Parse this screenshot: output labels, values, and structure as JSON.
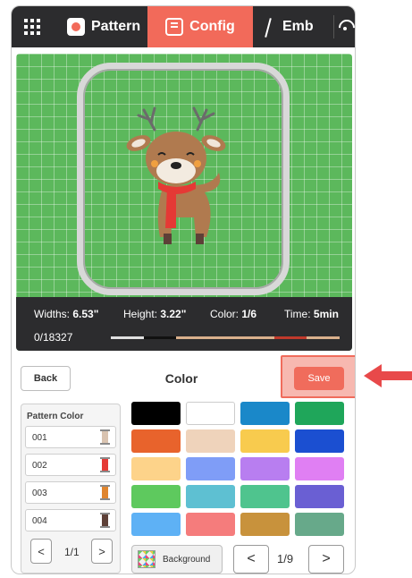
{
  "topbar": {
    "tabs": [
      {
        "label": "Pattern",
        "icon": "pattern-icon"
      },
      {
        "label": "Config",
        "icon": "config-icon",
        "active": true
      },
      {
        "label": "Emb",
        "icon": "needle-icon"
      }
    ]
  },
  "stats": {
    "widths_label": "Widths: ",
    "widths_value": "6.53\"",
    "height_label": "Height: ",
    "height_value": "3.22\"",
    "color_label": "Color: ",
    "color_value": "1/6",
    "time_label": "Time: ",
    "time_value": "5min",
    "counter": "0/18327",
    "progress_colors": [
      "#e0e0e0",
      "#111111",
      "#d9b08c",
      "#d9b08c",
      "#d9b08c",
      "#c0392b",
      "#d9b08c"
    ]
  },
  "panel": {
    "back_label": "Back",
    "title": "Color",
    "save_label": "Save",
    "pattern_color_title": "Pattern Color",
    "pattern_colors": [
      {
        "num": "001",
        "color": "#d9c3b0"
      },
      {
        "num": "002",
        "color": "#e53935"
      },
      {
        "num": "003",
        "color": "#e0852e"
      },
      {
        "num": "004",
        "color": "#5d4037"
      }
    ],
    "pattern_pager": {
      "prev": "<",
      "text": "1/1",
      "next": ">"
    },
    "palette": [
      "#000000",
      "#ffffff",
      "#1a88c9",
      "#1fa65a",
      "#e8632c",
      "#efd3bb",
      "#f8cb4e",
      "#1b4fd1",
      "#fdd38a",
      "#7f9df7",
      "#b87ef0",
      "#e07ff3",
      "#5ec95e",
      "#5ec0d2",
      "#4fc48e",
      "#6a5fd3",
      "#5eb1f5",
      "#f57c7c",
      "#c8923c",
      "#67a98a"
    ],
    "background_label": "Background",
    "palette_pager": {
      "prev": "<",
      "text": "1/9",
      "next": ">"
    }
  }
}
